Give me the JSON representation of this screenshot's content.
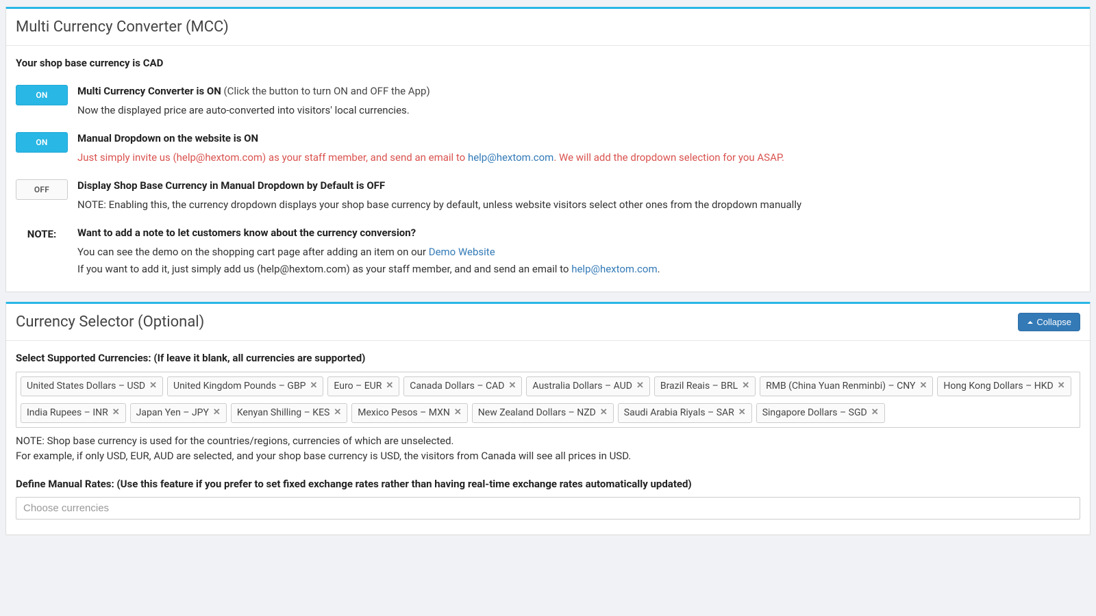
{
  "panel1": {
    "title": "Multi Currency Converter (MCC)",
    "base_currency_line": "Your shop base currency is CAD",
    "rows": [
      {
        "toggle": "ON",
        "toggle_state": "on",
        "title": "Multi Currency Converter is ON",
        "hint": " (Click the button to turn ON and OFF the App)",
        "desc": "Now the displayed price are auto-converted into visitors' local currencies."
      },
      {
        "toggle": "ON",
        "toggle_state": "on",
        "title": "Manual Dropdown on the website is ON",
        "hint": "",
        "invite_pre": "Just simply invite us (help@hextom.com) as your staff member, and send an email to ",
        "invite_link": "help@hextom.com",
        "invite_post": ". We will add the dropdown selection for you ASAP."
      },
      {
        "toggle": "OFF",
        "toggle_state": "off",
        "title": "Display Shop Base Currency in Manual Dropdown by Default is OFF",
        "hint": "",
        "desc": "NOTE: Enabling this, the currency dropdown displays your shop base currency by default, unless website visitors select other ones from the dropdown manually"
      }
    ],
    "note": {
      "label": "NOTE:",
      "title": "Want to add a note to let customers know about the currency conversion?",
      "line1_pre": "You can see the demo on the shopping cart page after adding an item on our ",
      "line1_link": "Demo Website",
      "line2_pre": "If you want to add it, just simply add us (help@hextom.com) as your staff member, and and send an email to ",
      "line2_link": "help@hextom.com",
      "line2_post": "."
    }
  },
  "panel2": {
    "title": "Currency Selector (Optional)",
    "collapse_label": "Collapse",
    "select_label": "Select Supported Currencies: (If leave it blank, all currencies are supported)",
    "currencies": [
      "United States Dollars – USD",
      "United Kingdom Pounds – GBP",
      "Euro – EUR",
      "Canada Dollars – CAD",
      "Australia Dollars – AUD",
      "Brazil Reais – BRL",
      "RMB (China Yuan Renminbi) – CNY",
      "Hong Kong Dollars – HKD",
      "India Rupees – INR",
      "Japan Yen – JPY",
      "Kenyan Shilling – KES",
      "Mexico Pesos – MXN",
      "New Zealand Dollars – NZD",
      "Saudi Arabia Riyals – SAR",
      "Singapore Dollars – SGD"
    ],
    "note_line1": "NOTE: Shop base currency is used for the countries/regions, currencies of which are unselected.",
    "note_line2": "For example, if only USD, EUR, AUD are selected, and your shop base currency is USD, the visitors from Canada will see all prices in USD.",
    "manual_rates_label": "Define Manual Rates: (Use this feature if you prefer to set fixed exchange rates rather than having real-time exchange rates automatically updated)",
    "manual_rates_placeholder": "Choose currencies"
  }
}
